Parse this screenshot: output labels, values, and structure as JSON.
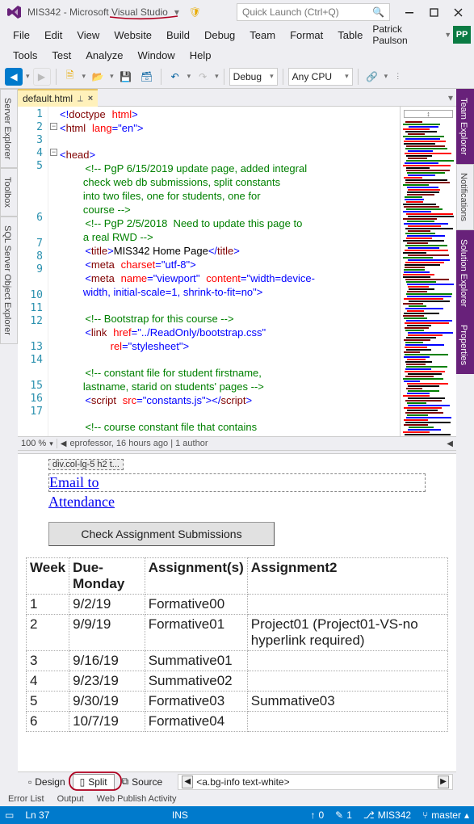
{
  "titlebar": {
    "title": "MIS342 - Microsoft Visual Studio"
  },
  "quick_launch": {
    "placeholder": "Quick Launch (Ctrl+Q)"
  },
  "menu1": [
    "File",
    "Edit",
    "View",
    "Website",
    "Build",
    "Debug",
    "Team",
    "Format",
    "Table"
  ],
  "menu2": [
    "Tools",
    "Test",
    "Analyze",
    "Window",
    "Help"
  ],
  "user": {
    "name": "Patrick Paulson",
    "initials": "PP",
    "badge_bg": "#0a7b43"
  },
  "toolbar": {
    "config": "Debug",
    "platform": "Any CPU"
  },
  "doc_tab": {
    "name": "default.html"
  },
  "zoom_bar": {
    "zoom": "100 %",
    "codelens": "eprofessor, 16 hours ago",
    "authors": "1 author"
  },
  "code": {
    "lines": [
      {
        "n": 1,
        "html": "<span class='ang'>&lt;!</span><span class='tag'>doctype</span> <span class='attr'>html</span><span class='ang'>&gt;</span>"
      },
      {
        "n": 2,
        "html": "<span class='ang'>&lt;</span><span class='tag'>html</span> <span class='attr'>lang</span><span class='punct'>=</span><span class='punct'>\"</span><span class='val'>en</span><span class='punct'>\"</span><span class='ang'>&gt;</span>"
      },
      {
        "n": 3,
        "html": ""
      },
      {
        "n": 4,
        "html": "<span class='ang'>&lt;</span><span class='tag'>head</span><span class='ang'>&gt;</span>"
      },
      {
        "n": 5,
        "html": "    <span class='comment'>&lt;!-- PgP 6/15/2019 update page, added integral<br>        check web db submissions, split constants<br>        into two files, one for students, one for<br>        course --&gt;</span>"
      },
      {
        "n": 6,
        "html": "    <span class='comment'>&lt;!-- PgP 2/5/2018  Need to update this page to<br>        a real RWD --&gt;</span>"
      },
      {
        "n": 7,
        "html": "    <span class='ang'>&lt;</span><span class='tag'>title</span><span class='ang'>&gt;</span><span class='text'>MIS342 Home Page</span><span class='ang'>&lt;/</span><span class='tag'>title</span><span class='ang'>&gt;</span>"
      },
      {
        "n": 8,
        "html": "    <span class='ang'>&lt;</span><span class='tag'>meta</span> <span class='attr'>charset</span><span class='punct'>=\"</span><span class='val'>utf-8</span><span class='punct'>\"</span><span class='ang'>&gt;</span>"
      },
      {
        "n": 9,
        "html": "    <span class='ang'>&lt;</span><span class='tag'>meta</span> <span class='attr'>name</span><span class='punct'>=\"</span><span class='val'>viewport</span><span class='punct'>\"</span> <span class='attr'>content</span><span class='punct'>=\"</span><span class='val'>width=device-<br>        width, initial-scale=1, shrink-to-fit=no</span><span class='punct'>\"</span><span class='ang'>&gt;</span>"
      },
      {
        "n": 10,
        "html": ""
      },
      {
        "n": 11,
        "html": "    <span class='comment'>&lt;!-- Bootstrap for this course --&gt;</span>"
      },
      {
        "n": 12,
        "html": "    <span class='ang'>&lt;</span><span class='tag'>link</span> <span class='attr'>href</span><span class='punct'>=\"</span><span class='val'>../ReadOnly/bootstrap.css</span><span class='punct'>\"</span><br>        <span class='attr'>rel</span><span class='punct'>=\"</span><span class='val'>stylesheet</span><span class='punct'>\"</span><span class='ang'>&gt;</span>"
      },
      {
        "n": 13,
        "html": ""
      },
      {
        "n": 14,
        "html": "    <span class='comment'>&lt;!-- constant file for student firstname,<br>        lastname, starid on students' pages --&gt;</span>"
      },
      {
        "n": 15,
        "html": "    <span class='ang'>&lt;</span><span class='tag'>script</span> <span class='attr'>src</span><span class='punct'>=\"</span><span class='val'>constants.js</span><span class='punct'>\"</span><span class='ang'>&gt;&lt;/</span><span class='tag'>script</span><span class='ang'>&gt;</span>"
      },
      {
        "n": 16,
        "html": ""
      },
      {
        "n": 17,
        "html": "    <span class='comment'>&lt;!-- course constant file that contains</span>"
      }
    ]
  },
  "design": {
    "breadcrumb_small": "div.col-lg-5 h2 t...",
    "email_link": "Email to",
    "attendance_link": "Attendance",
    "check_button": "Check Assignment Submissions",
    "table": {
      "headers": [
        "Week",
        "Due-Monday",
        "Assignment(s)",
        "Assignment2"
      ],
      "rows": [
        [
          "1",
          "9/2/19",
          "Formative00",
          ""
        ],
        [
          "2",
          "9/9/19",
          "Formative01",
          "Project01  (Project01-VS-no hyperlink required)"
        ],
        [
          "3",
          "9/16/19",
          "Summative01",
          ""
        ],
        [
          "4",
          "9/23/19",
          "Summative02",
          ""
        ],
        [
          "5",
          "9/30/19",
          "Formative03",
          "Summative03"
        ],
        [
          "6",
          "10/7/19",
          "Formative04",
          ""
        ]
      ]
    }
  },
  "view_selector": {
    "design": "Design",
    "split": "Split",
    "source": "Source",
    "breadcrumb": "<a.bg-info text-white>"
  },
  "bottom_tabs": [
    "Error List",
    "Output",
    "Web Publish Activity"
  ],
  "status": {
    "line": "Ln 37",
    "ins": "INS",
    "up": "0",
    "down": "1",
    "repo": "MIS342",
    "branch": "master"
  },
  "right_tabs": [
    "Team Explorer",
    "Notifications",
    "Solution Explorer",
    "Properties"
  ],
  "left_tabs": [
    "Server Explorer",
    "Toolbox",
    "SQL Server Object Explorer"
  ],
  "annotation_color": "#b00020"
}
